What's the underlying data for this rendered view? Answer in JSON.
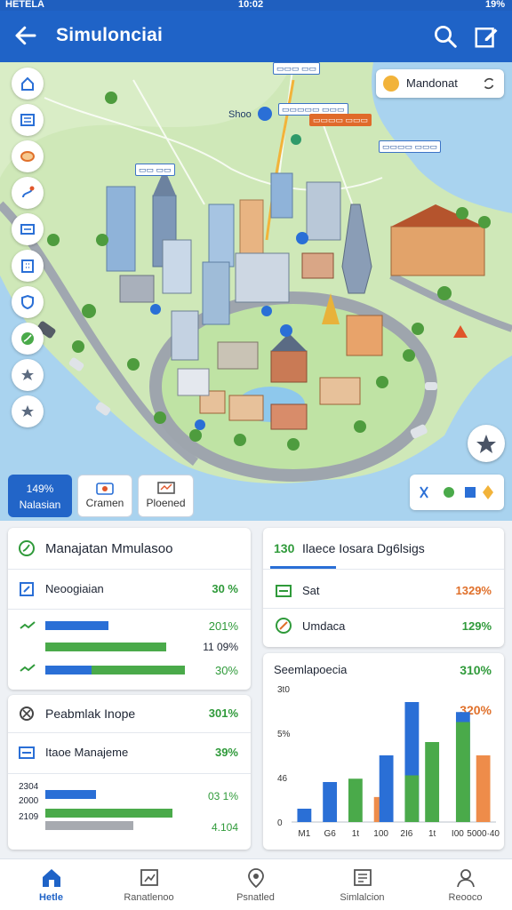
{
  "status_bar": {
    "left": "HETELA",
    "time": "10:02",
    "right": "19%"
  },
  "app_bar": {
    "title": "Simulonciai"
  },
  "map": {
    "user_name": "Mandonat",
    "labels": [
      "Shoo"
    ],
    "mode_tabs": [
      {
        "icon": "percent-icon",
        "value": "149%",
        "label": "Nalasian"
      },
      {
        "icon": "camera-icon",
        "value": "",
        "label": "Cramen"
      },
      {
        "icon": "monitor-icon",
        "value": "",
        "label": "Ploened"
      }
    ]
  },
  "panel_left_top": {
    "title": "Manajatan Mmulasoo",
    "row1": {
      "label": "Neoogiaian",
      "value": "30 %"
    },
    "bars": [
      {
        "value": "201%",
        "fill": 0.43
      },
      {
        "value": "11 09%",
        "fill": 0.82
      },
      {
        "value": "30%",
        "fill": 0.9
      }
    ]
  },
  "panel_right_top": {
    "title_prefix": "130",
    "title": "Ilaece Iosara Dg6lsigs",
    "rows": [
      {
        "label": "Sat",
        "value": "1329%"
      },
      {
        "label": "Umdaca",
        "value": "129%"
      }
    ]
  },
  "panel_left_bottom": {
    "title": "Peabmlak Inope",
    "title_value": "301%",
    "row1": {
      "label": "Itaoe Manajeme",
      "value": "39%"
    },
    "bar_axis": [
      "2304",
      "2000",
      "2109"
    ],
    "bars": [
      {
        "value": "03 1%",
        "fill": 0.4
      },
      {
        "value": "",
        "fill": 0.68
      },
      {
        "value": "4.104",
        "fill": 0.5
      }
    ]
  },
  "chart_panel": {
    "title": "Seemlapoecia",
    "title_value": "310%",
    "side_value": "320%",
    "colors": {
      "blue": "#2a6fd6",
      "green": "#4aaa4a",
      "orange": "#ee8c4a"
    }
  },
  "chart_data": {
    "type": "bar",
    "title": "Seemlapoecia",
    "y_tick_labels": [
      "0",
      "46",
      "5%",
      "3t0"
    ],
    "categories": [
      "M1",
      "G6",
      "1t",
      "100",
      "2I6",
      "1t",
      "I00",
      "5000·40"
    ],
    "series": [
      {
        "values": [
          8,
          24,
          0,
          0,
          0,
          0,
          0,
          0
        ],
        "color": "#2a6fd6"
      },
      {
        "values": [
          0,
          0,
          26,
          0,
          0,
          48,
          0,
          0
        ],
        "color": "#4aaa4a"
      },
      {
        "values": [
          0,
          0,
          0,
          15,
          0,
          0,
          0,
          40
        ],
        "color": "#ee8c4a"
      },
      {
        "values": [
          0,
          0,
          0,
          40,
          72,
          0,
          66,
          0
        ],
        "color": "#2a6fd6"
      },
      {
        "values": [
          0,
          0,
          0,
          0,
          28,
          0,
          60,
          0
        ],
        "color": "#4aaa4a"
      }
    ],
    "ylim": [
      0,
      80
    ]
  },
  "bottom_nav": [
    {
      "label": "Hetle",
      "active": true
    },
    {
      "label": "Ranatlenoo",
      "active": false
    },
    {
      "label": "Psnatled",
      "active": false
    },
    {
      "label": "Simlalcion",
      "active": false
    },
    {
      "label": "Reooco",
      "active": false
    }
  ]
}
